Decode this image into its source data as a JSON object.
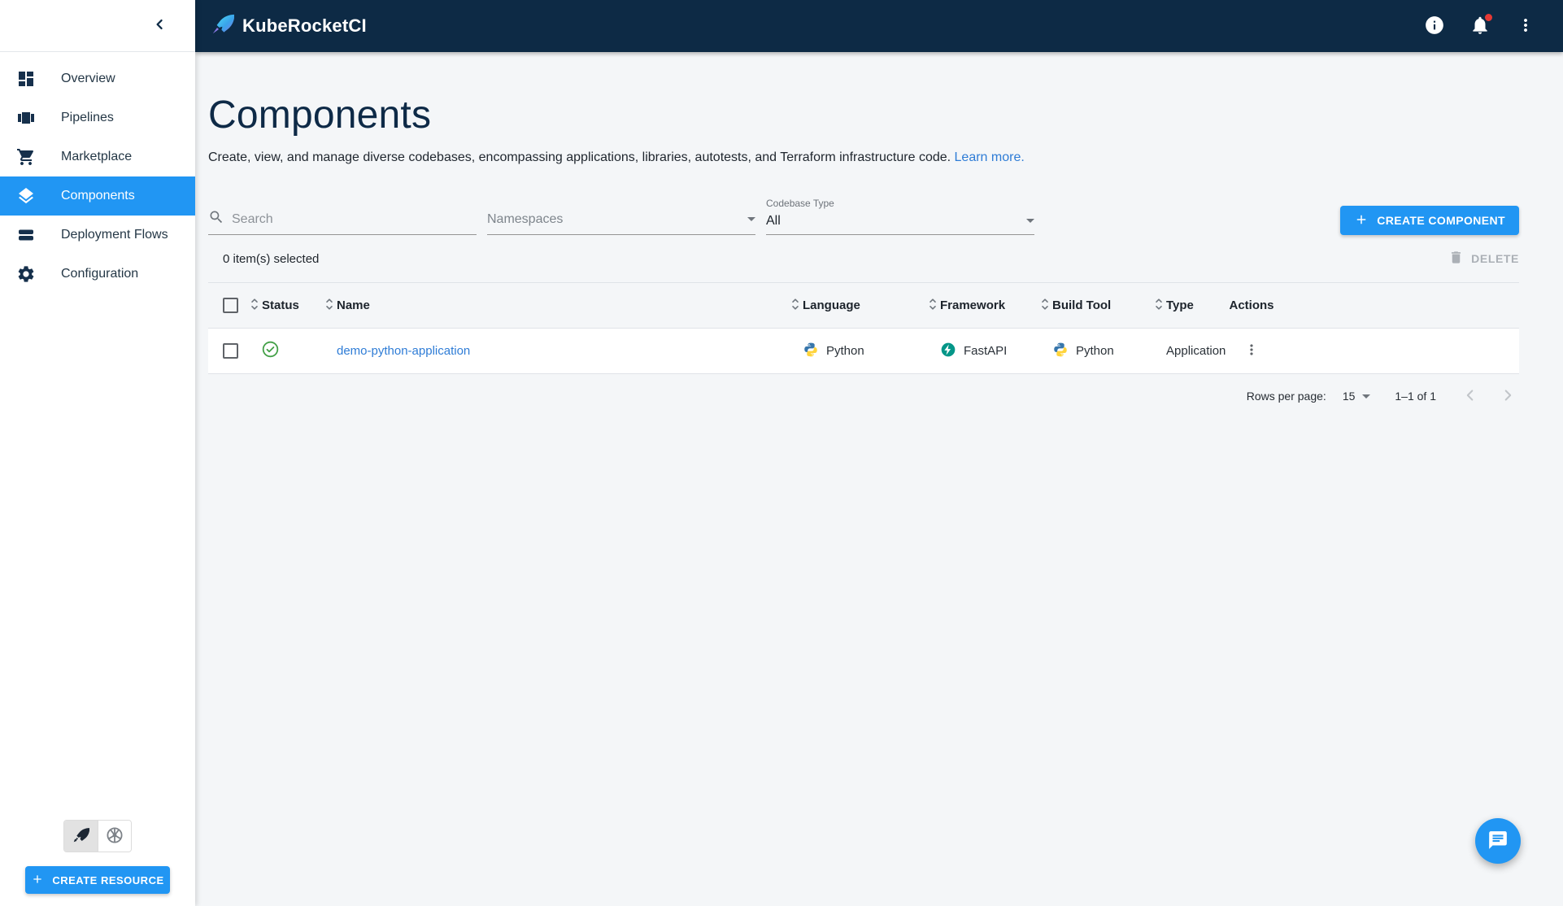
{
  "app": {
    "title": "KubeRocketCI"
  },
  "sidebar": {
    "items": [
      {
        "label": "Overview"
      },
      {
        "label": "Pipelines"
      },
      {
        "label": "Marketplace"
      },
      {
        "label": "Components"
      },
      {
        "label": "Deployment Flows"
      },
      {
        "label": "Configuration"
      }
    ],
    "create_resource_label": "CREATE RESOURCE"
  },
  "page": {
    "title": "Components",
    "description": "Create, view, and manage diverse codebases, encompassing applications, libraries, autotests, and Terraform infrastructure code.",
    "learn_more": "Learn more."
  },
  "filters": {
    "search_placeholder": "Search",
    "namespaces_label": "Namespaces",
    "codebase_type_label": "Codebase Type",
    "codebase_type_value": "All",
    "create_component_label": "CREATE COMPONENT"
  },
  "selection": {
    "text": "0 item(s) selected",
    "delete_label": "DELETE"
  },
  "table": {
    "columns": [
      "Status",
      "Name",
      "Language",
      "Framework",
      "Build Tool",
      "Type",
      "Actions"
    ],
    "rows": [
      {
        "status": "success",
        "name": "demo-python-application",
        "language": "Python",
        "framework": "FastAPI",
        "build_tool": "Python",
        "type": "Application"
      }
    ]
  },
  "pagination": {
    "rows_per_page_label": "Rows per page:",
    "rows_per_page_value": "15",
    "range": "1–1 of 1"
  },
  "icons": {
    "status_success": "check-circle",
    "language_row": "python-icon",
    "framework_row": "fastapi-icon",
    "build_tool_row": "python-icon"
  },
  "colors": {
    "header_bg": "#0d2a45",
    "accent": "#2196f3",
    "success": "#43a047",
    "link": "#2e7cd6",
    "notification_badge": "#e53935"
  }
}
